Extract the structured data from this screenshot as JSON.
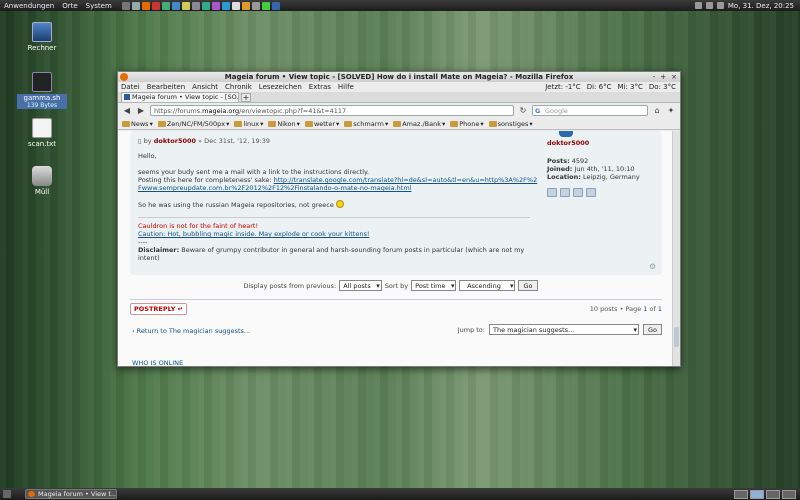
{
  "top_panel": {
    "menus": [
      "Anwendungen",
      "Orte",
      "System"
    ],
    "clock": "Mo, 31. Dez, 20:25"
  },
  "desktop": {
    "icons": [
      {
        "label": "Rechner",
        "sub": ""
      },
      {
        "label": "gamma.sh",
        "sub": "139 Bytes"
      },
      {
        "label": "scan.txt",
        "sub": ""
      },
      {
        "label": "Müll",
        "sub": ""
      }
    ]
  },
  "window": {
    "title": "Mageia forum • View topic - [SOLVED] How do i install Mate on Mageia? - Mozilla Firefox",
    "controls": [
      "-",
      "+",
      "×"
    ],
    "menu": [
      "Datei",
      "Bearbeiten",
      "Ansicht",
      "Chronik",
      "Lesezeichen",
      "Extras",
      "Hilfe"
    ],
    "weather": [
      "Jetzt: -1°C",
      "Di: 6°C",
      "Mi: 3°C",
      "Do: 3°C"
    ],
    "tab_label": "Mageia forum • View topic - [SO...",
    "new_tab": "+",
    "url_prefix": "https://forums.",
    "url_host": "mageia.org",
    "url_suffix": "/en/viewtopic.php?f=41&t=4117",
    "search_placeholder": "Google",
    "bookmarks": [
      "News",
      "Zen/NC/FM/500px",
      "linux",
      "Nikon",
      "wetter",
      "schmarrn",
      "Amaz./Bank",
      "Phone",
      "sonstiges"
    ]
  },
  "post": {
    "by": "by",
    "author": "doktor5000",
    "date": "» Dec 31st, '12, 19:39",
    "greeting": "Hello,",
    "line1": "seems your budy sent me a mail with a link to the instructions directly.",
    "line2": "Posting this here for completeness' sake:",
    "link": "http://translate.google.com/translate?hl=de&sl=auto&tl=en&u=http%3A%2F%2Fwww.sempreupdate.com.br%2F2012%2F12%2Finstalando-o-mate-no-mageia.html",
    "line3": "So he was using the russian Mageia repositories, not greece",
    "sig_red": "Cauldron is not for the faint of heart!",
    "sig_link": "Caution: Hot, bubbling magic inside. May explode or cook your kittens!",
    "sig_dash": "----",
    "disclaimer_label": "Disclaimer:",
    "disclaimer_text": "Beware of grumpy contributor in general and harsh-sounding forum posts in particular (which are not my intent)"
  },
  "profile": {
    "username": "doktor5000",
    "posts_label": "Posts:",
    "posts": "4592",
    "joined_label": "Joined:",
    "joined": "Jun 4th, '11, 10:10",
    "location_label": "Location:",
    "location": "Leipzig, Germany"
  },
  "sort": {
    "display_label": "Display posts from previous:",
    "display_value": "All posts",
    "sortby_label": "Sort by",
    "sortby_value": "Post time",
    "order_value": "Ascending",
    "go": "Go"
  },
  "actions": {
    "postreply": "POSTREPLY",
    "pageinfo": "10 posts • Page",
    "page_current": "1",
    "page_of": "of",
    "page_total": "1",
    "return_link": "‹ Return to The magician suggests...",
    "jump_label": "Jump to:",
    "jump_value": "The magician suggests...",
    "jump_go": "Go",
    "whos_online": "WHO IS ONLINE"
  },
  "bottom_panel": {
    "task": "Mageia forum • View t..."
  }
}
